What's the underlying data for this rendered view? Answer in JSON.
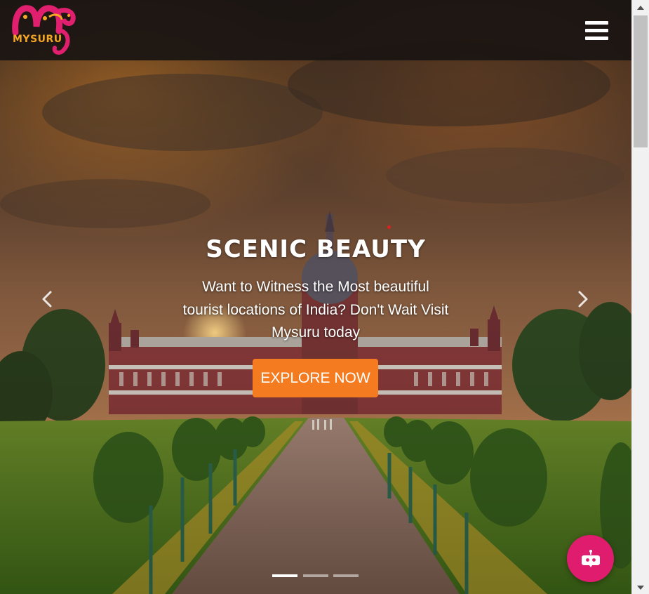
{
  "navbar": {
    "logo_text": "MYSURU",
    "menu_icon": "hamburger-menu-icon"
  },
  "hero": {
    "title": "SCENIC BEAUTY",
    "text": "Want to Witness the Most beautiful tourist locations of India? Don't Wait Visit Mysuru today",
    "button_label": "EXPLORE NOW",
    "prev_icon": "chevron-left-icon",
    "next_icon": "chevron-right-icon",
    "slides_total": 3,
    "active_slide": 1
  },
  "chat": {
    "icon": "chatbot-icon"
  },
  "colors": {
    "accent_orange": "#f47b1f",
    "chat_pink": "#df1c6e",
    "logo_pink": "#e0206e",
    "logo_orange": "#f5a623",
    "navbar_bg": "#1a1412"
  }
}
